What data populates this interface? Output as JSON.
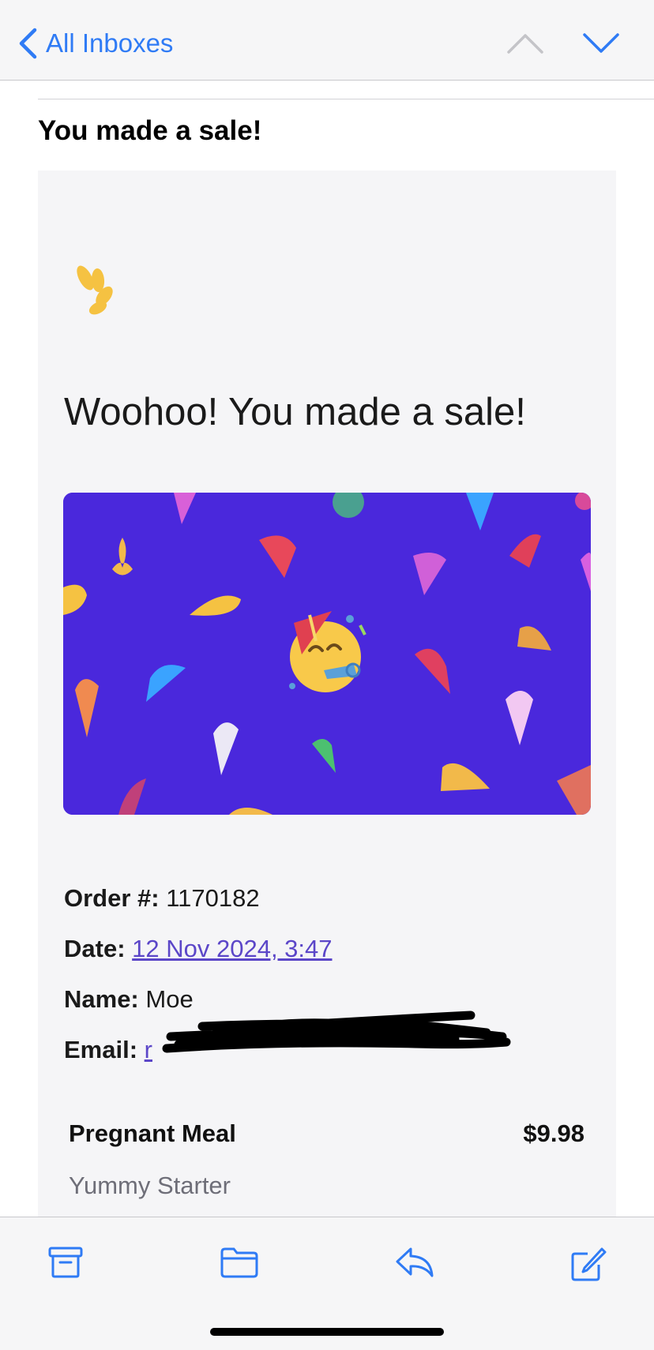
{
  "navbar": {
    "back_label": "All Inboxes"
  },
  "email": {
    "subject": "You made a sale!",
    "headline": "Woohoo! You made a sale!",
    "order_label": "Order #:",
    "order_value": "1170182",
    "date_label": "Date:",
    "date_value": "12 Nov 2024, 3:47",
    "name_label": "Name:",
    "name_value": "Moe",
    "email_label": "Email:",
    "email_visible_char": "r",
    "product_name": "Pregnant Meal",
    "product_price": "$9.98",
    "product_variant": "Yummy Starter"
  },
  "colors": {
    "accent": "#2f7bf5",
    "banner_bg": "#4a28dc",
    "link": "#5b46c8",
    "logo": "#f5c242"
  },
  "icons": {
    "back": "chevron-left-icon",
    "prev": "chevron-up-icon",
    "next": "chevron-down-icon",
    "archive": "archive-icon",
    "move": "folder-icon",
    "reply": "reply-icon",
    "compose": "compose-icon",
    "banner_emoji": "party-face-icon"
  }
}
